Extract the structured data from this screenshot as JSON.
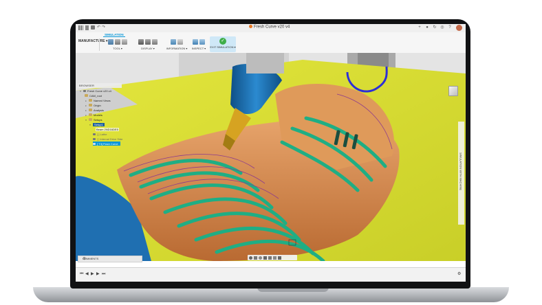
{
  "app": {
    "document_title": "Fresh Curve v20 v4",
    "workspace": "MANUFACTURE",
    "active_tab": "SIMULATION"
  },
  "toolbar": {
    "groups": [
      {
        "label": "TOOL ▾"
      },
      {
        "label": "DISPLAY ▾"
      },
      {
        "label": "INFORMATION ▾"
      },
      {
        "label": "INSPECT ▾"
      }
    ],
    "exit_label": "EXIT SIMULATION ▾"
  },
  "browser": {
    "header": "BROWSER",
    "items": [
      {
        "label": "Fresh Curve v20 v4"
      },
      {
        "label": "CAM_root"
      },
      {
        "label": "Named Views"
      },
      {
        "label": "Origin"
      },
      {
        "label": "Analysis"
      },
      {
        "label": "Models"
      },
      {
        "label": "Setups"
      },
      {
        "label": "Setup1"
      },
      {
        "label": "Beam 2ND16DE5"
      },
      {
        "label": "[ ] Lathe"
      },
      {
        "label": "[ ] Internal Drive Side"
      },
      {
        "label": "[ T3] Flash Curve"
      }
    ]
  },
  "side_panel": {
    "label": "SIMULATION WITH MACHINE"
  },
  "comments": {
    "label": "COMMENTS"
  },
  "colors": {
    "accent": "#0696d7",
    "part_orange": "#d98a4a",
    "toolpath_green": "#2fb38a",
    "floor_yellow": "#d6dc2e",
    "spindle_blue": "#1a73b6"
  }
}
